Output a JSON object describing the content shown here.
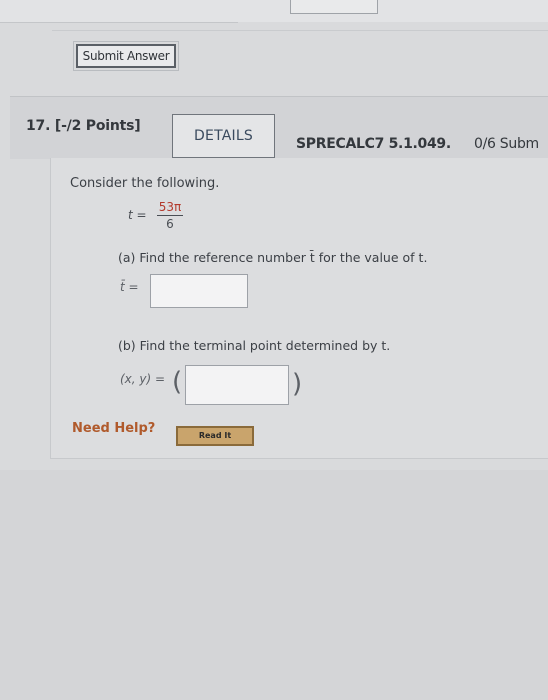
{
  "submit": {
    "label": "Submit Answer"
  },
  "question": {
    "number_points": "17. [-/2 Points]",
    "details_label": "DETAILS",
    "code": "SPRECALC7 5.1.049.",
    "submissions": "0/6 Subm"
  },
  "problem": {
    "intro": "Consider the following.",
    "t_label": "t =",
    "t_numerator": "53π",
    "t_denominator": "6",
    "part_a": "(a) Find the reference number t̄ for the value of t.",
    "part_a_label": "t̄ =",
    "part_a_value": "",
    "part_b": "(b) Find the terminal point determined by t.",
    "part_b_label": "(x, y) =",
    "part_b_value": "",
    "paren_open": "(",
    "paren_close": ")"
  },
  "help": {
    "label": "Need Help?",
    "read_it": "Read It"
  },
  "colors": {
    "accent_red": "#b33a2d",
    "need_help": "#b05a2c",
    "read_it_bg": "#c9a46c"
  }
}
